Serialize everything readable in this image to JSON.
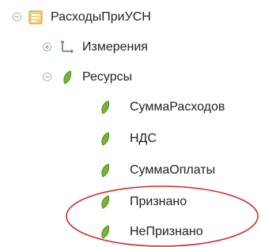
{
  "tree": {
    "root": {
      "label": "РасходыПриУСН",
      "icon": "register-icon",
      "expanded": true
    },
    "children": [
      {
        "label": "Измерения",
        "icon": "dimensions-icon",
        "expanded": false
      },
      {
        "label": "Ресурсы",
        "icon": "resource-icon",
        "expanded": true,
        "items": [
          {
            "label": "СуммаРасходов",
            "icon": "resource-icon"
          },
          {
            "label": "НДС",
            "icon": "resource-icon"
          },
          {
            "label": "СуммаОплаты",
            "icon": "resource-icon"
          },
          {
            "label": "Признано",
            "icon": "resource-icon"
          },
          {
            "label": "НеПризнано",
            "icon": "resource-icon"
          }
        ]
      }
    ]
  },
  "colors": {
    "resource_leaf": "#7ab23b",
    "resource_leaf_dark": "#4f8a1f",
    "register_icon": "#e8b93b",
    "highlight_ellipse": "#d62828"
  }
}
